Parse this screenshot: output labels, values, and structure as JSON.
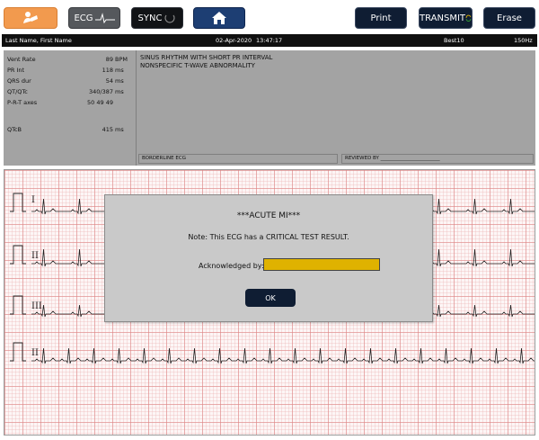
{
  "toolbar": {
    "ecg_label": "ECG",
    "sync_label": "SYNC",
    "print_label": "Print",
    "transmit_label": "TRANSMIT",
    "erase_label": "Erase",
    "colors": {
      "active": "#f29a4e",
      "home": "#1d3e73",
      "dark": "#0f1d33"
    },
    "icons": {
      "patient": "patient-icon",
      "home": "home-icon",
      "sync": "sync-circle-icon",
      "transmit": "transmit-arrows-icon"
    }
  },
  "patient_bar": {
    "name": "Last Name, First Name",
    "date": "02-Apr-2020",
    "time": "13:47:17",
    "filter_label": "Best10",
    "frequency": "150Hz"
  },
  "measurements": [
    {
      "label": "Vent Rate",
      "value": "89",
      "unit": "BPM"
    },
    {
      "label": "PR Int",
      "value": "118",
      "unit": "ms"
    },
    {
      "label": "QRS dur",
      "value": "54",
      "unit": "ms"
    },
    {
      "label": "QT/QTc",
      "value": "340/387",
      "unit": "ms"
    },
    {
      "label": "P-R-T axes",
      "value": "50 49 49",
      "unit": ""
    },
    {
      "label": "QTcB",
      "value": "415",
      "unit": "ms"
    }
  ],
  "interpretation": {
    "line1": "SINUS RHYTHM WITH SHORT PR INTERVAL",
    "line2": "NONSPECIFIC T-WAVE ABNORMALITY"
  },
  "footer": {
    "classification": "BORDERLINE ECG",
    "reviewed_by": "REVIEWED BY ________________________"
  },
  "leads": [
    "I",
    "II",
    "III",
    "II"
  ],
  "dialog": {
    "title": "***ACUTE MI***",
    "note": "Note:  This ECG has a CRITICAL TEST RESULT.",
    "ack_label": "Acknowledged by:",
    "ack_value": "",
    "ok_label": "OK",
    "field_color": "#dfb200"
  }
}
